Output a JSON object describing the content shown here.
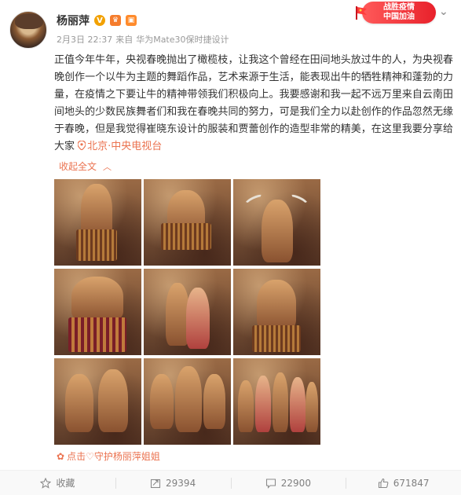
{
  "post": {
    "author": {
      "name": "杨丽萍",
      "verified_icon": "verified-badge-icon",
      "vip_icon": "weibo-vip-icon",
      "member_icon": "member-icon"
    },
    "meta": {
      "time": "2月3日 22:37",
      "source_prefix": "来自",
      "source": "华为Mate30保时捷设计"
    },
    "badge": {
      "line1": "战胜疫情",
      "line2": "中国加油"
    },
    "text": "正值今年牛年，央视春晚抛出了橄榄枝，让我这个曾经在田间地头放过牛的人，为央视春晚创作一个以牛为主题的舞蹈作品，艺术来源于生活，能表现出牛的牺牲精神和蓬勃的力量，在疫情之下要让牛的精神带领我们积极向上。我要感谢和我一起不远万里来自云南田间地头的少数民族舞者们和我在春晚共同的努力，可是我们全力以赴创作的作品忽然无缘于春晚，但是我觉得崔晓东设计的服装和贾蕾创作的造型非常的精美，在这里我要分享给大家",
    "location": "北京·中央电视台",
    "collapse_label": "收起全文",
    "photos_count": 9,
    "support_label": "点击♡守护杨丽萍姐姐"
  },
  "actions": {
    "favorite": {
      "label": "收藏",
      "icon": "star-icon"
    },
    "repost": {
      "count": "29394",
      "icon": "repost-icon"
    },
    "comment": {
      "count": "22900",
      "icon": "comment-icon"
    },
    "like": {
      "count": "671847",
      "icon": "thumb-up-icon"
    }
  },
  "colors": {
    "accent": "#eb7350",
    "text": "#333333",
    "meta": "#999999",
    "badge": "#e8212b"
  }
}
